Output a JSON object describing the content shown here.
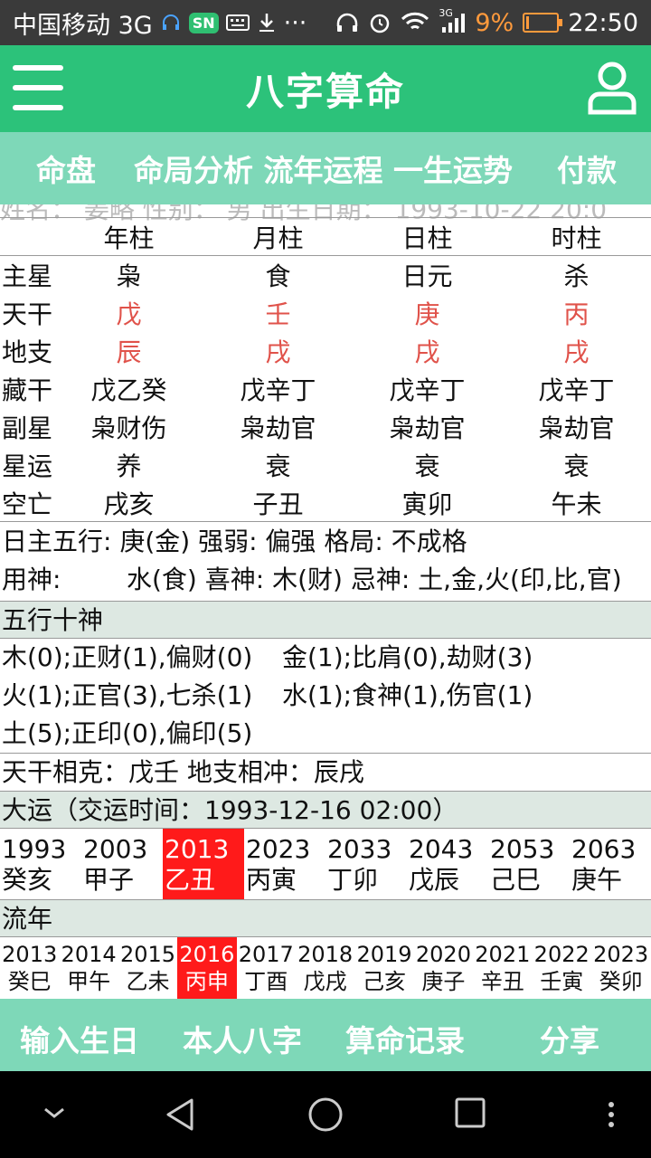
{
  "status": {
    "carrier": "中国移动 3G",
    "sn_badge": "SN",
    "dots": "···",
    "net": "3G",
    "battery_pct": "9%",
    "time": "22:50"
  },
  "app": {
    "title": "八字算命"
  },
  "tabs": {
    "t1": "命盘",
    "t2": "命局分析 流年运程 一生运势",
    "t3": "付款"
  },
  "clipped_info": "姓名：  姜略   性别：  男   出生日期：  1993-10-22 20:0",
  "pillars": {
    "headers": [
      "年柱",
      "月柱",
      "日柱",
      "时柱"
    ],
    "rows": [
      {
        "label": "主星",
        "values": [
          "枭",
          "食",
          "日元",
          "杀"
        ]
      },
      {
        "label": "天干",
        "values": [
          "戊",
          "壬",
          "庚",
          "丙"
        ]
      },
      {
        "label": "地支",
        "values": [
          "辰",
          "戌",
          "戌",
          "戌"
        ]
      },
      {
        "label": "藏干",
        "values": [
          "戊乙癸",
          "戊辛丁",
          "戊辛丁",
          "戊辛丁"
        ]
      },
      {
        "label": "副星",
        "values": [
          "枭财伤",
          "枭劫官",
          "枭劫官",
          "枭劫官"
        ]
      },
      {
        "label": "星运",
        "values": [
          "养",
          "衰",
          "衰",
          "衰"
        ]
      },
      {
        "label": "空亡",
        "values": [
          "戌亥",
          "子丑",
          "寅卯",
          "午未"
        ]
      }
    ]
  },
  "summary": {
    "line1": "日主五行: 庚(金)  强弱: 偏强    格局: 不成格",
    "line2_a": "用神:",
    "line2_b": "水(食)  喜神: 木(财)  忌神: 土,金,火(印,比,官)"
  },
  "wuxing": {
    "title": "五行十神",
    "rows": [
      [
        "木(0);正财(1),偏财(0)",
        "金(1);比肩(0),劫财(3)"
      ],
      [
        "火(1);正官(3),七杀(1)",
        "水(1);食神(1),伤官(1)"
      ],
      [
        "土(5);正印(0),偏印(5)",
        ""
      ]
    ]
  },
  "relations": "天干相克：戊壬  地支相冲：辰戌",
  "dayun": {
    "title": "大运（交运时间：1993-12-16 02:00）",
    "items": [
      {
        "year": "1993",
        "gz": "癸亥"
      },
      {
        "year": "2003",
        "gz": "甲子"
      },
      {
        "year": "2013",
        "gz": "乙丑"
      },
      {
        "year": "2023",
        "gz": "丙寅"
      },
      {
        "year": "2033",
        "gz": "丁卯"
      },
      {
        "year": "2043",
        "gz": "戊辰"
      },
      {
        "year": "2053",
        "gz": "己巳"
      },
      {
        "year": "2063",
        "gz": "庚午"
      }
    ]
  },
  "liunian": {
    "title": "流年",
    "items": [
      {
        "year": "2013",
        "gz": "癸巳"
      },
      {
        "year": "2014",
        "gz": "甲午"
      },
      {
        "year": "2015",
        "gz": "乙未"
      },
      {
        "year": "2016",
        "gz": "丙申"
      },
      {
        "year": "2017",
        "gz": "丁酉"
      },
      {
        "year": "2018",
        "gz": "戊戌"
      },
      {
        "year": "2019",
        "gz": "己亥"
      },
      {
        "year": "2020",
        "gz": "庚子"
      },
      {
        "year": "2021",
        "gz": "辛丑"
      },
      {
        "year": "2022",
        "gz": "壬寅"
      },
      {
        "year": "2023",
        "gz": "癸卯"
      }
    ]
  },
  "bottom": {
    "b1": "输入生日",
    "b2": "本人八字",
    "b3": "算命记录",
    "b4": "分享"
  },
  "colors": {
    "appbar": "#2cc27a",
    "tabbar": "#7ed8b8",
    "highlight": "#ff1a1a",
    "red_text": "#e0524a"
  }
}
